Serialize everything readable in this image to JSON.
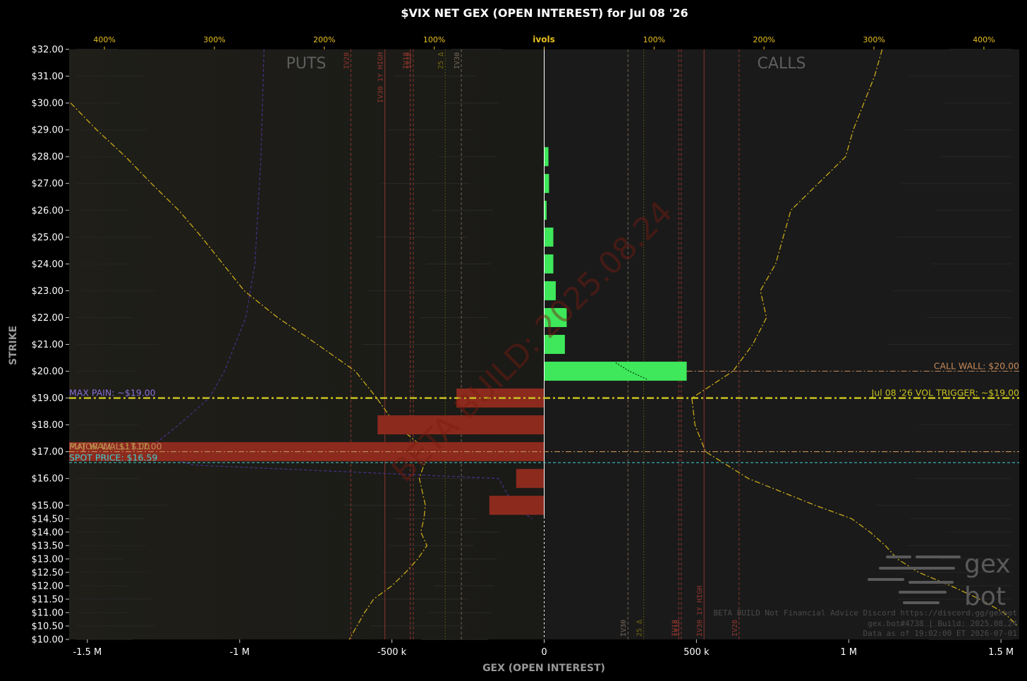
{
  "chart_data": {
    "type": "bar",
    "orientation": "horizontal",
    "title": "$VIX NET GEX (OPEN INTEREST) for Jul 08 '26",
    "xlabel": "GEX (OPEN INTEREST)",
    "ylabel": "STRIKE",
    "top_axis_label": "ivols",
    "xlim": [
      -1560000,
      1560000
    ],
    "ylim": [
      10,
      32
    ],
    "x_ticks": [
      {
        "value": -1500000,
        "label": "-1.5 M"
      },
      {
        "value": -1000000,
        "label": "-1 M"
      },
      {
        "value": -500000,
        "label": "-500 k"
      },
      {
        "value": 0,
        "label": "0"
      },
      {
        "value": 500000,
        "label": "500 k"
      },
      {
        "value": 1000000,
        "label": "1 M"
      },
      {
        "value": 1500000,
        "label": "1.5 M"
      }
    ],
    "top_ticks": [
      {
        "value": -1444000,
        "label": "400%"
      },
      {
        "value": -1083000,
        "label": "300%"
      },
      {
        "value": -722000,
        "label": "200%"
      },
      {
        "value": -361000,
        "label": "100%"
      },
      {
        "value": 361000,
        "label": "100%"
      },
      {
        "value": 722000,
        "label": "200%"
      },
      {
        "value": 1083000,
        "label": "300%"
      },
      {
        "value": 1444000,
        "label": "400%"
      }
    ],
    "y_ticks": [
      {
        "value": 32,
        "label": "$32.00"
      },
      {
        "value": 31,
        "label": "$31.00"
      },
      {
        "value": 30,
        "label": "$30.00"
      },
      {
        "value": 29,
        "label": "$29.00"
      },
      {
        "value": 28,
        "label": "$28.00"
      },
      {
        "value": 27,
        "label": "$27.00"
      },
      {
        "value": 26,
        "label": "$26.00"
      },
      {
        "value": 25,
        "label": "$25.00"
      },
      {
        "value": 24,
        "label": "$24.00"
      },
      {
        "value": 23,
        "label": "$23.00"
      },
      {
        "value": 22,
        "label": "$22.00"
      },
      {
        "value": 21,
        "label": "$21.00"
      },
      {
        "value": 20,
        "label": "$20.00"
      },
      {
        "value": 19,
        "label": "$19.00"
      },
      {
        "value": 18,
        "label": "$18.00"
      },
      {
        "value": 17,
        "label": "$17.00"
      },
      {
        "value": 16,
        "label": "$16.00"
      },
      {
        "value": 15,
        "label": "$15.00"
      },
      {
        "value": 14.5,
        "label": "$14.50"
      },
      {
        "value": 14,
        "label": "$14.00"
      },
      {
        "value": 13.5,
        "label": "$13.50"
      },
      {
        "value": 13,
        "label": "$13.00"
      },
      {
        "value": 12.5,
        "label": "$12.50"
      },
      {
        "value": 12,
        "label": "$12.00"
      },
      {
        "value": 11.5,
        "label": "$11.50"
      },
      {
        "value": 11,
        "label": "$11.00"
      },
      {
        "value": 10.5,
        "label": "$10.50"
      },
      {
        "value": 10,
        "label": "$10.00"
      }
    ],
    "bars": [
      {
        "strike": 28,
        "value": 14000
      },
      {
        "strike": 27,
        "value": 16000
      },
      {
        "strike": 26,
        "value": 8000
      },
      {
        "strike": 25,
        "value": 30000
      },
      {
        "strike": 24,
        "value": 30000
      },
      {
        "strike": 23,
        "value": 38000
      },
      {
        "strike": 22,
        "value": 74000
      },
      {
        "strike": 21,
        "value": 68000
      },
      {
        "strike": 20,
        "value": 468000
      },
      {
        "strike": 19,
        "value": -288000
      },
      {
        "strike": 18,
        "value": -547000
      },
      {
        "strike": 17,
        "value": -1560000
      },
      {
        "strike": 16,
        "value": -92000
      },
      {
        "strike": 15,
        "value": -180000
      }
    ],
    "levels": [
      {
        "name": "MAX PAIN",
        "label": "MAX PAIN: ~$19.00",
        "strike": 19,
        "side": "left",
        "color": "#8a6fd8",
        "style": "none"
      },
      {
        "name": "VOL TRIGGER",
        "label": "Jul 08 '26 VOL TRIGGER: ~$19.00",
        "strike": 19,
        "side": "right",
        "color": "#c8c020",
        "style": "thick"
      },
      {
        "name": "CALL WALL",
        "label": "CALL WALL: $20.00",
        "strike": 20,
        "side": "right",
        "color": "#c48a5a",
        "style": "dashdot"
      },
      {
        "name": "PUT WALL",
        "label": "PUT WALL: $17.00",
        "strike": 17,
        "side": "left",
        "color": "#b09a40",
        "style": "dashdot"
      },
      {
        "name": "MAJOR WALL",
        "label": "MAJOR WALL: $17.00",
        "strike": 17,
        "side": "left",
        "color": "#c48a5a",
        "style": "dashdot"
      },
      {
        "name": "SPOT PRICE",
        "label": "SPOT PRICE: $16.59",
        "strike": 16.59,
        "side": "left",
        "color": "#40d0d0",
        "style": "dashed"
      }
    ],
    "vlines": [
      {
        "label": "IV28",
        "x": -635000,
        "color": "#a03a30",
        "style": "dash"
      },
      {
        "label": "IV30 1Y HIGH",
        "x": -523000,
        "color": "#a03a30",
        "style": "solid"
      },
      {
        "label": "IV18",
        "x": -440000,
        "color": "#a03a30",
        "style": "dash"
      },
      {
        "label": "IV18",
        "x": -430000,
        "color": "#a03a30",
        "style": "dash"
      },
      {
        "label": "IV30",
        "x": -272000,
        "color": "#807060",
        "style": "dash"
      },
      {
        "label": "25 Δ",
        "x": -325000,
        "color": "#7a7010",
        "style": "dot"
      },
      {
        "label": "IV30",
        "x": 275000,
        "color": "#807060",
        "style": "dash"
      },
      {
        "label": "25 Δ",
        "x": 327000,
        "color": "#7a7010",
        "style": "dot"
      },
      {
        "label": "IV18",
        "x": 442000,
        "color": "#a03a30",
        "style": "dash"
      },
      {
        "label": "IV18",
        "x": 450000,
        "color": "#a03a30",
        "style": "dash"
      },
      {
        "label": "IV30 1Y HIGH",
        "x": 525000,
        "color": "#a03a30",
        "style": "solid"
      },
      {
        "label": "IV28",
        "x": 640000,
        "color": "#a03a30",
        "style": "dash"
      }
    ],
    "side_labels": {
      "left": "PUTS",
      "right": "CALLS"
    },
    "ivol_put_curve": [
      [
        32,
        null
      ],
      [
        30,
        -1555000
      ],
      [
        29,
        -1470000
      ],
      [
        28,
        -1375000
      ],
      [
        27,
        -1290000
      ],
      [
        26,
        -1200000
      ],
      [
        25,
        -1125000
      ],
      [
        24,
        -1055000
      ],
      [
        23,
        -985000
      ],
      [
        22,
        -875000
      ],
      [
        21,
        -745000
      ],
      [
        20,
        -620000
      ],
      [
        19,
        -550000
      ],
      [
        18,
        -487000
      ],
      [
        17,
        -380000
      ],
      [
        16,
        -410000
      ],
      [
        15,
        -390000
      ],
      [
        14.5,
        -395000
      ],
      [
        14,
        -405000
      ],
      [
        13.5,
        -385000
      ],
      [
        13,
        -415000
      ],
      [
        12.5,
        -455000
      ],
      [
        12,
        -500000
      ],
      [
        11.5,
        -560000
      ],
      [
        11,
        -590000
      ],
      [
        10.5,
        -615000
      ],
      [
        10,
        -640000
      ]
    ],
    "ivol_call_curve": [
      [
        32,
        1110000
      ],
      [
        31,
        1085000
      ],
      [
        30,
        1050000
      ],
      [
        29,
        1015000
      ],
      [
        28,
        990000
      ],
      [
        27,
        900000
      ],
      [
        26,
        810000
      ],
      [
        25,
        785000
      ],
      [
        24,
        760000
      ],
      [
        23,
        710000
      ],
      [
        22,
        730000
      ],
      [
        21,
        685000
      ],
      [
        20,
        620000
      ],
      [
        19,
        485000
      ],
      [
        18,
        495000
      ],
      [
        17,
        530000
      ],
      [
        16,
        670000
      ],
      [
        15,
        890000
      ],
      [
        14.5,
        1010000
      ],
      [
        14,
        1070000
      ],
      [
        13.5,
        1120000
      ],
      [
        13,
        1160000
      ],
      [
        12.5,
        1230000
      ],
      [
        12,
        1335000
      ],
      [
        11.5,
        1430000
      ],
      [
        11,
        1510000
      ],
      [
        10.5,
        1555000
      ]
    ],
    "purple_curve": [
      [
        32,
        -920000
      ],
      [
        28,
        -930000
      ],
      [
        24,
        -950000
      ],
      [
        22,
        -980000
      ],
      [
        20,
        -1050000
      ],
      [
        19,
        -1100000
      ],
      [
        18,
        -1200000
      ],
      [
        17,
        -1310000
      ],
      [
        16.5,
        -1150000
      ],
      [
        16,
        -150000
      ],
      [
        15,
        -100000
      ],
      [
        14.5,
        -40000
      ]
    ],
    "legend": null
  },
  "watermark": {
    "text": "BETA BUILD: 2025.08.24"
  },
  "logo": {
    "line1": "gex",
    "line2": "bot"
  },
  "footer": {
    "line1": "BETA BUILD Not Financial Advice Discord https://discord.gg/gexbot",
    "line2": "gex.bot#4738 | Build: 2025.08.24",
    "line3": "Data as of 19:02:00 ET 2026-07-01"
  },
  "colors": {
    "background": "#000000",
    "plot_bg": "#1a1a1a",
    "positive_bar": "#3ee85a",
    "negative_bar": "#8c2a1e",
    "ivol_curve": "#c8a818",
    "tick_gold": "#e8c020",
    "zero_line": "#ffffff"
  }
}
